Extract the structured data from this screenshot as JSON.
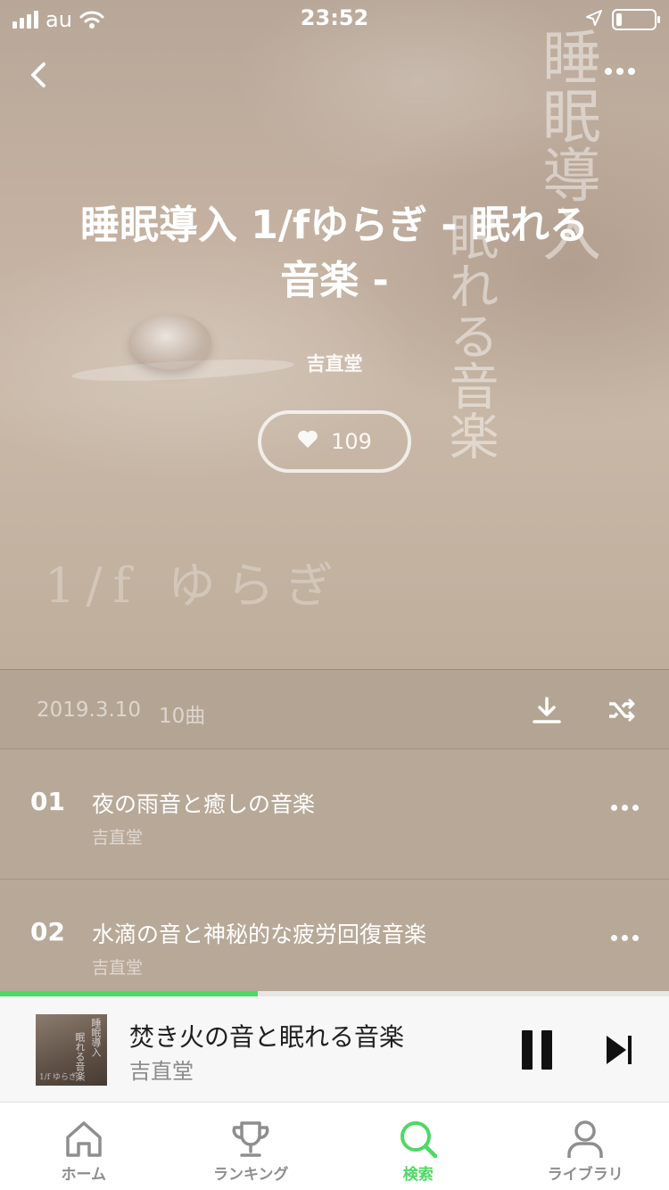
{
  "status_bar": {
    "carrier": "au",
    "time": "23:52"
  },
  "cover": {
    "vertical_col1": "睡眠導入",
    "vertical_col2": "眠れる音楽",
    "small_text": "1/f ゆらぎ"
  },
  "album": {
    "title": "睡眠導入 1/fゆらぎ - 眠れる音楽 -",
    "artist": "吉直堂",
    "like_count": "109",
    "release_date": "2019.3.10",
    "track_count": "10曲"
  },
  "tracks": [
    {
      "number": "01",
      "title": "夜の雨音と癒しの音楽",
      "artist": "吉直堂"
    },
    {
      "number": "02",
      "title": "水滴の音と神秘的な疲労回復音楽",
      "artist": "吉直堂"
    }
  ],
  "now_playing": {
    "title": "焚き火の音と眠れる音楽",
    "artist": "吉直堂",
    "progress": 0.385,
    "art_text_col1": "睡眠導入",
    "art_text_col2": "眠れる音楽",
    "art_small": "1/f ゆらぎ"
  },
  "tabs": [
    {
      "label": "ホーム",
      "icon": "home-icon",
      "active": false
    },
    {
      "label": "ランキング",
      "icon": "trophy-icon",
      "active": false
    },
    {
      "label": "検索",
      "icon": "search-icon",
      "active": true
    },
    {
      "label": "ライブラリ",
      "icon": "person-icon",
      "active": false
    }
  ],
  "colors": {
    "accent": "#4cd964",
    "list_background": "#b8a897",
    "tab_inactive": "#8e8e8e"
  }
}
